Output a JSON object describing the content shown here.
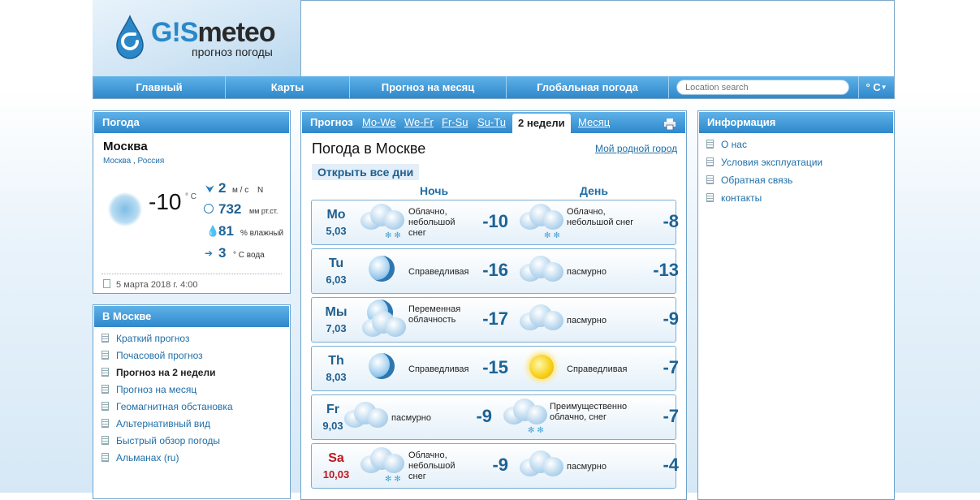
{
  "header": {
    "logo_text_gis": "G!S",
    "logo_text_meteo": "meteo",
    "logo_subtitle": "прогноз погоды"
  },
  "nav": {
    "items": [
      "Главный",
      "Карты",
      "Прогноз на месяц",
      "Глобальная погода"
    ],
    "search_placeholder": "Location search",
    "unit_label": "° C"
  },
  "weather_panel": {
    "title": "Погода",
    "city": "Москва",
    "breadcrumb": [
      "Москва",
      "Россия"
    ],
    "temperature": "-10",
    "temp_unit": "° C",
    "wind_value": "2",
    "wind_unit": "м / с",
    "wind_dir": "N",
    "pressure_value": "732",
    "pressure_unit": "мм рт.ст.",
    "humidity_value": "81",
    "humidity_unit": "%  влажный",
    "water_value": "3",
    "water_unit": "° C  вода",
    "timestamp": "5 марта 2018 г. 4:00"
  },
  "city_panel": {
    "title": "В Москве",
    "items": [
      "Краткий прогноз",
      "Почасовой прогноз",
      "Прогноз на 2 недели",
      "Прогноз на месяц",
      "Геомагнитная обстановка",
      "Альтернативный вид",
      "Быстрый обзор погоды",
      "Альманах (ru)"
    ],
    "active_index": 2
  },
  "forecast": {
    "tabs": [
      "Прогноз",
      "Mo-We",
      "We-Fr",
      "Fr-Su",
      "Su-Tu",
      "2 недели",
      "Месяц"
    ],
    "active_tab": "2 недели",
    "print_icon": "printer-icon",
    "title": "Погода в Москве",
    "home_link": "Мой родной город",
    "open_all": "Открыть все дни",
    "night_label": "Ночь",
    "day_label": "День",
    "days": [
      {
        "day": "Mo",
        "date": "5,03",
        "night_icon": "cloud-snow-icon",
        "night_desc": "Облачно, небольшой снег",
        "night_temp": "-10",
        "day_icon": "cloud-snow-icon",
        "day_desc": "Облачно, небольшой снег",
        "day_temp": "-8",
        "weekend": false
      },
      {
        "day": "Tu",
        "date": "6,03",
        "night_icon": "moon-icon",
        "night_desc": "Справедливая",
        "night_temp": "-16",
        "day_icon": "cloud-icon",
        "day_desc": "пасмурно",
        "day_temp": "-13",
        "weekend": false
      },
      {
        "day": "Мы",
        "date": "7,03",
        "night_icon": "moon-cloud-icon",
        "night_desc": "Переменная облачность",
        "night_temp": "-17",
        "day_icon": "cloud-icon",
        "day_desc": "пасмурно",
        "day_temp": "-9",
        "weekend": false
      },
      {
        "day": "Th",
        "date": "8,03",
        "night_icon": "moon-icon",
        "night_desc": "Справедливая",
        "night_temp": "-15",
        "day_icon": "sun-icon",
        "day_desc": "Справедливая",
        "day_temp": "-7",
        "weekend": false
      },
      {
        "day": "Fr",
        "date": "9,03",
        "night_icon": "cloud-icon",
        "night_desc": "пасмурно",
        "night_temp": "-9",
        "day_icon": "cloud-snow-icon",
        "day_desc": "Преимущественно облачно, снег",
        "day_temp": "-7",
        "weekend": false
      },
      {
        "day": "Sa",
        "date": "10,03",
        "night_icon": "cloud-snow-icon",
        "night_desc": "Облачно, небольшой снег",
        "night_temp": "-9",
        "day_icon": "cloud-icon",
        "day_desc": "пасмурно",
        "day_temp": "-4",
        "weekend": true
      }
    ]
  },
  "info_panel": {
    "title": "Информация",
    "items": [
      "О нас",
      "Условия эксплуатации",
      "Обратная связь",
      "контакты"
    ]
  },
  "colors": {
    "accent": "#2f88cb",
    "link": "#1f6fa8",
    "temp": "#1d6395",
    "weekend": "#c0181e"
  }
}
